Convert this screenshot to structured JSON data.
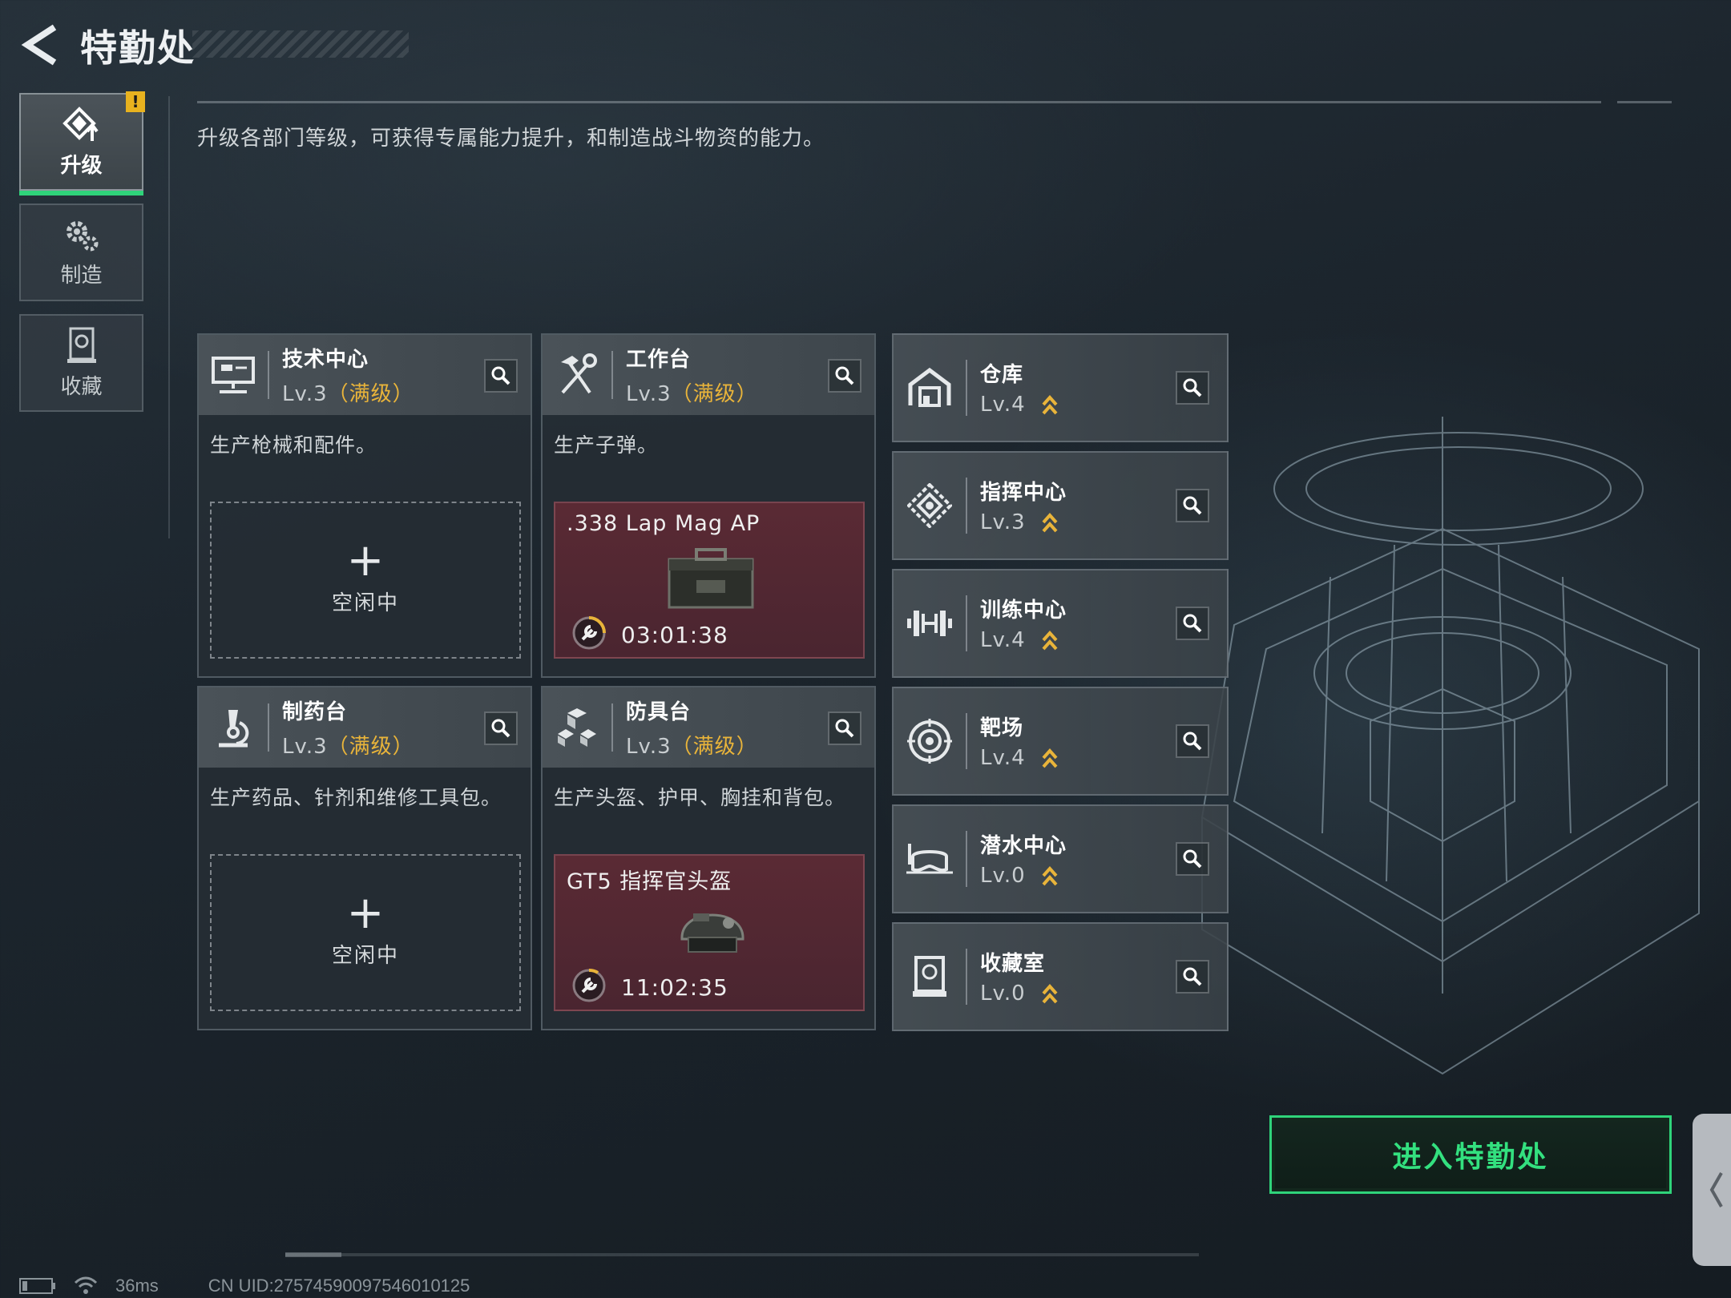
{
  "header": {
    "title": "特勤处"
  },
  "description": "升级各部门等级，可获得专属能力提升，和制造战斗物资的能力。",
  "side_tabs": [
    {
      "label": "升级",
      "active": true,
      "badge": "!"
    },
    {
      "label": "制造",
      "active": false
    },
    {
      "label": "收藏",
      "active": false
    }
  ],
  "cards": [
    {
      "name": "技术中心",
      "level": "Lv.3",
      "level_note": "（满级）",
      "desc": "生产枪械和配件。",
      "slot_plus": "+",
      "slot_status": "空闲中"
    },
    {
      "name": "工作台",
      "level": "Lv.3",
      "level_note": "（满级）",
      "desc": "生产子弹。",
      "item": ".338 Lap Mag AP",
      "timer": "03:01:38"
    },
    {
      "name": "制药台",
      "level": "Lv.3",
      "level_note": "（满级）",
      "desc": "生产药品、针剂和维修工具包。",
      "slot_plus": "+",
      "slot_status": "空闲中"
    },
    {
      "name": "防具台",
      "level": "Lv.3",
      "level_note": "（满级）",
      "desc": "生产头盔、护甲、胸挂和背包。",
      "item": "GT5 指挥官头盔",
      "timer": "11:02:35"
    }
  ],
  "facilities": [
    {
      "name": "仓库",
      "level": "Lv.4"
    },
    {
      "name": "指挥中心",
      "level": "Lv.3"
    },
    {
      "name": "训练中心",
      "level": "Lv.4"
    },
    {
      "name": "靶场",
      "level": "Lv.4"
    },
    {
      "name": "潜水中心",
      "level": "Lv.0"
    },
    {
      "name": "收藏室",
      "level": "Lv.0"
    }
  ],
  "enter_button": "进入特勤处",
  "status": {
    "ping": "36ms",
    "uid": "CN UID:27574590097546010125"
  },
  "colors": {
    "accent_green": "#2fd37a",
    "max_level_gold": "#e9b43a",
    "busy_slot": "#5a2a34"
  }
}
